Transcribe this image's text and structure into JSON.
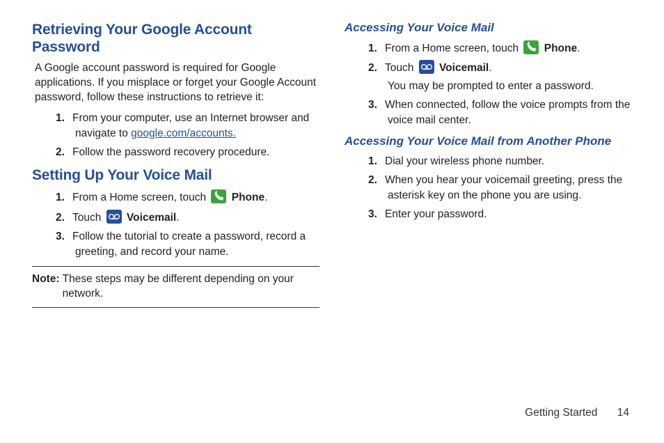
{
  "left": {
    "h_google": "Retrieving Your Google Account Password",
    "p_google": "A Google account password is required for Google applications. If you misplace or forget your Google Account password, follow these instructions to retrieve it:",
    "google_steps": {
      "s1_pre": "From your computer, use an Internet browser and navigate to ",
      "s1_link": "google.com/accounts.",
      "s2": "Follow the password recovery procedure."
    },
    "h_vm": "Setting Up Your Voice Mail",
    "vm_steps": {
      "s1_pre": "From a Home screen, touch ",
      "s1_post": "Phone",
      "s1_end": ".",
      "s2_pre": "Touch ",
      "s2_post": "Voicemail",
      "s2_end": ".",
      "s3": "Follow the tutorial to create a password, record a greeting, and record your name."
    },
    "note_label": "Note:",
    "note_text": "These steps may be different depending on your network."
  },
  "right": {
    "h_access": "Accessing Your Voice Mail",
    "access_steps": {
      "s1_pre": "From a Home screen, touch ",
      "s1_post": "Phone",
      "s1_end": ".",
      "s2_pre": "Touch ",
      "s2_post": "Voicemail",
      "s2_end": ".",
      "s2_extra": "You may be prompted to enter a password.",
      "s3": "When connected, follow the voice prompts from the voice mail center."
    },
    "h_other": "Accessing Your Voice Mail from Another Phone",
    "other_steps": {
      "s1": "Dial your wireless phone number.",
      "s2": "When you hear your voicemail greeting, press the asterisk key on the phone you are using.",
      "s3": "Enter your password."
    }
  },
  "labels": {
    "n1": "1.",
    "n2": "2.",
    "n3": "3."
  },
  "footer": {
    "section": "Getting Started",
    "page": "14"
  }
}
